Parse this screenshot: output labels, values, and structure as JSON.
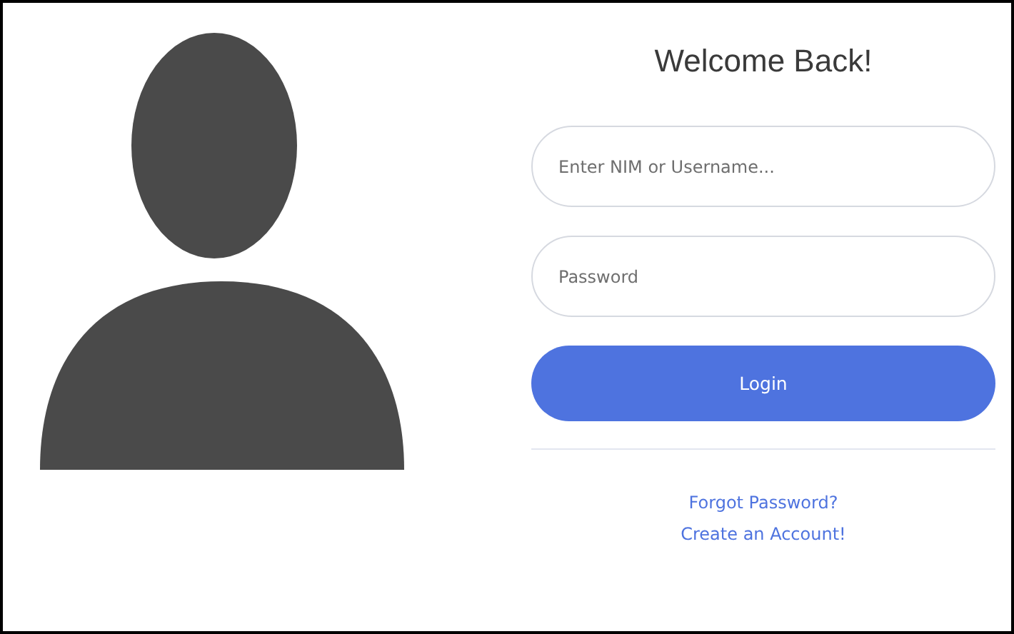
{
  "title": "Welcome Back!",
  "fields": [
    {
      "placeholder": "Enter NIM or Username..."
    },
    {
      "placeholder": "Password"
    }
  ],
  "login_button": "Login",
  "links": [
    "Forgot Password?",
    "Create an Account!"
  ]
}
